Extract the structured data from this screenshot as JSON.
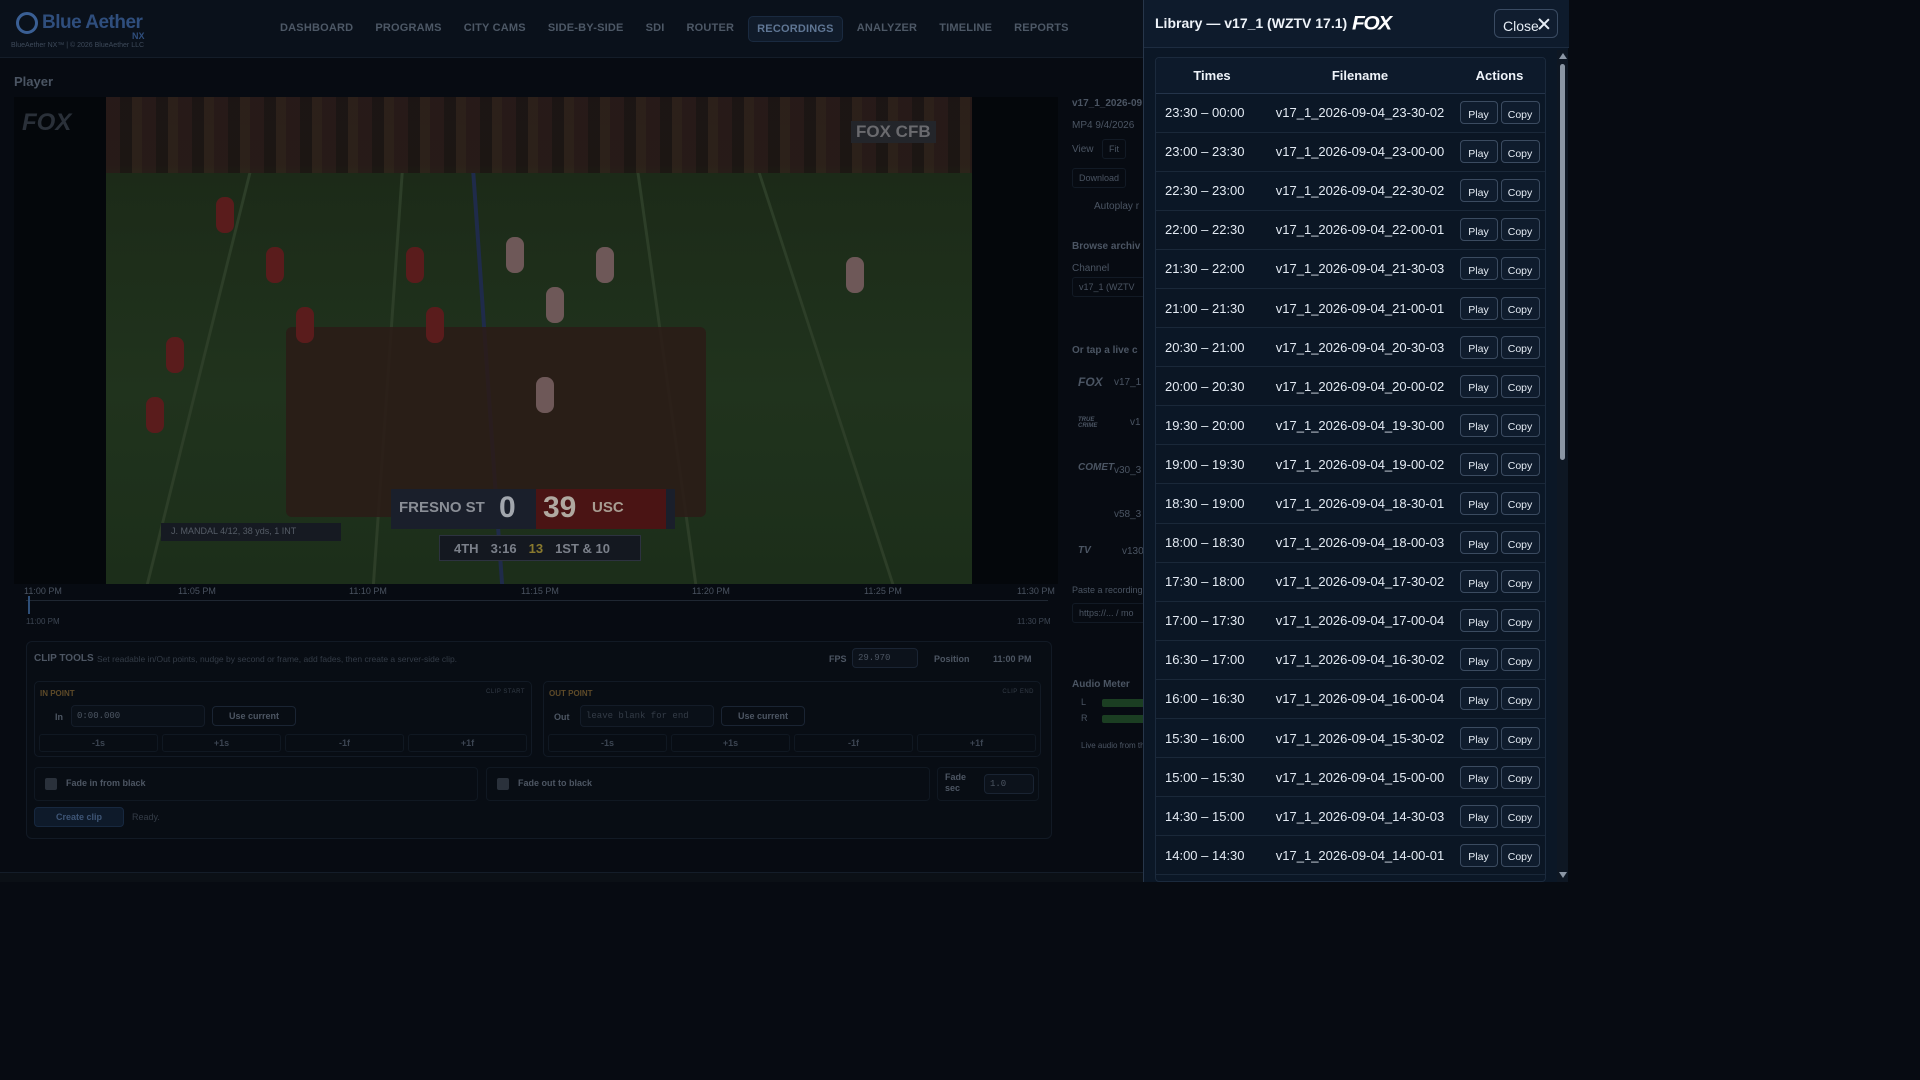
{
  "app": {
    "brand": "Blue Aether",
    "brand_suffix": "NX",
    "copyright": "BlueAether NX™ | © 2026 BlueAether LLC",
    "nav": [
      "DASHBOARD",
      "PROGRAMS",
      "CITY CAMS",
      "SIDE-BY-SIDE",
      "SDI",
      "ROUTER",
      "RECORDINGS",
      "ANALYZER",
      "TIMELINE",
      "REPORTS"
    ],
    "active_nav": "RECORDINGS",
    "section_title": "Player"
  },
  "player": {
    "watermark": "FOX",
    "bug": "FOX CFB",
    "scorebug": {
      "team1": "FRESNO ST",
      "score1": "0",
      "team2": "USC",
      "score2": "39",
      "quarter": "4TH",
      "clock": "3:16",
      "playclock": "13",
      "down": "1ST & 10"
    },
    "lower_info": "J. MANDAL   4/12, 38 yds, 1 INT"
  },
  "timeline": {
    "ticks": [
      "11:00 PM",
      "11:05 PM",
      "11:10 PM",
      "11:15 PM",
      "11:20 PM",
      "11:25 PM",
      "11:30 PM"
    ],
    "start": "11:00 PM",
    "end": "11:30 PM"
  },
  "clip_tools": {
    "title": "CLIP TOOLS",
    "desc": "Set readable in/Out points, nudge by second or frame, add fades, then create a server-side clip.",
    "fps_label": "FPS",
    "fps": "29.970",
    "position_label": "Position",
    "position": "11:00 PM",
    "in": {
      "header": "IN POINT",
      "tag": "CLIP START",
      "label": "In",
      "value": "0:00.000",
      "use": "Use current"
    },
    "out": {
      "header": "OUT POINT",
      "tag": "CLIP END",
      "label": "Out",
      "placeholder": "leave blank for end",
      "use": "Use current"
    },
    "nudges": [
      "-1s",
      "+1s",
      "-1f",
      "+1f"
    ],
    "fade_in": "Fade in from black",
    "fade_out": "Fade out to black",
    "fade_sec_label": "Fade sec",
    "fade_sec": "1.0",
    "create": "Create clip",
    "status": "Ready."
  },
  "side_panel": {
    "file": "v17_1_2026-09",
    "meta": "MP4 9/4/2026",
    "view": "View",
    "fit": "Fit",
    "download": "Download",
    "autoplay": "Autoplay r",
    "browse": "Browse archiv",
    "channel_label": "Channel",
    "channel": "v17_1 (WZTV",
    "live": "Or tap a live c",
    "chips": [
      "FOX",
      "TRUE CRIME",
      "COMET",
      "",
      "TV"
    ],
    "chip_labels": [
      "v17_1",
      "v1",
      "v30_3",
      "v58_3",
      "v130"
    ],
    "paste": "Paste a recording",
    "paste_ph": "https://... / mo",
    "audio": "Audio Meter",
    "audio_l": "L",
    "audio_r": "R",
    "audio_note": "Live audio from th"
  },
  "library": {
    "title": "Library — v17_1 (WZTV 17.1)",
    "logo": "FOX",
    "close": "Close",
    "headers": {
      "times": "Times",
      "filename": "Filename",
      "actions": "Actions"
    },
    "play_label": "Play",
    "copy_label": "Copy",
    "rows": [
      {
        "time": "23:30 – 00:00",
        "file": "v17_1_2026-09-04_23-30-02"
      },
      {
        "time": "23:00 – 23:30",
        "file": "v17_1_2026-09-04_23-00-00"
      },
      {
        "time": "22:30 – 23:00",
        "file": "v17_1_2026-09-04_22-30-02"
      },
      {
        "time": "22:00 – 22:30",
        "file": "v17_1_2026-09-04_22-00-01"
      },
      {
        "time": "21:30 – 22:00",
        "file": "v17_1_2026-09-04_21-30-03"
      },
      {
        "time": "21:00 – 21:30",
        "file": "v17_1_2026-09-04_21-00-01"
      },
      {
        "time": "20:30 – 21:00",
        "file": "v17_1_2026-09-04_20-30-03"
      },
      {
        "time": "20:00 – 20:30",
        "file": "v17_1_2026-09-04_20-00-02"
      },
      {
        "time": "19:30 – 20:00",
        "file": "v17_1_2026-09-04_19-30-00"
      },
      {
        "time": "19:00 – 19:30",
        "file": "v17_1_2026-09-04_19-00-02"
      },
      {
        "time": "18:30 – 19:00",
        "file": "v17_1_2026-09-04_18-30-01"
      },
      {
        "time": "18:00 – 18:30",
        "file": "v17_1_2026-09-04_18-00-03"
      },
      {
        "time": "17:30 – 18:00",
        "file": "v17_1_2026-09-04_17-30-02"
      },
      {
        "time": "17:00 – 17:30",
        "file": "v17_1_2026-09-04_17-00-04"
      },
      {
        "time": "16:30 – 17:00",
        "file": "v17_1_2026-09-04_16-30-02"
      },
      {
        "time": "16:00 – 16:30",
        "file": "v17_1_2026-09-04_16-00-04"
      },
      {
        "time": "15:30 – 16:00",
        "file": "v17_1_2026-09-04_15-30-02"
      },
      {
        "time": "15:00 – 15:30",
        "file": "v17_1_2026-09-04_15-00-00"
      },
      {
        "time": "14:30 – 15:00",
        "file": "v17_1_2026-09-04_14-30-03"
      },
      {
        "time": "14:00 – 14:30",
        "file": "v17_1_2026-09-04_14-00-01"
      }
    ]
  }
}
